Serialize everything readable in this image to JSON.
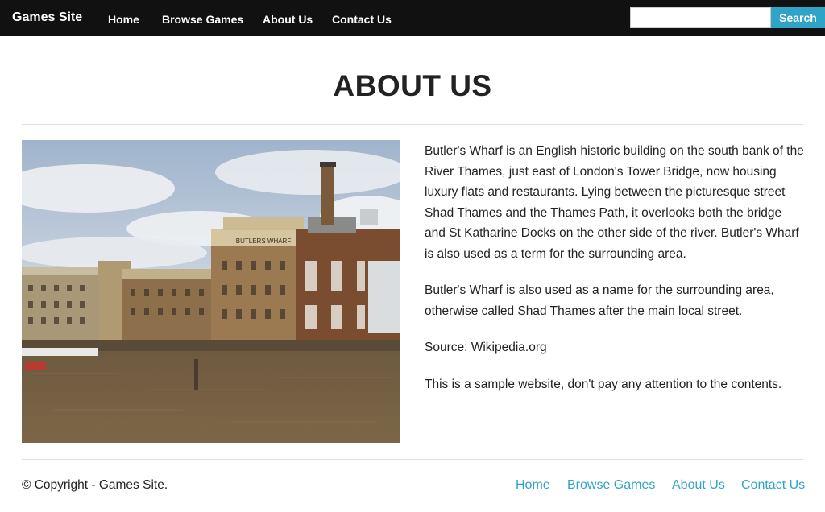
{
  "nav": {
    "brand": "Games Site",
    "links": [
      "Home",
      "Browse Games",
      "About Us",
      "Contact Us"
    ],
    "search_placeholder": "",
    "search_button": "Search"
  },
  "page": {
    "title": "ABOUT US",
    "image_alt": "Butler's Wharf building on the River Thames",
    "image_sign": "BUTLERS WHARF",
    "paragraphs": [
      "Butler's Wharf is an English historic building on the south bank of the River Thames, just east of London's Tower Bridge, now housing luxury flats and restaurants. Lying between the picturesque street Shad Thames and the Thames Path, it overlooks both the bridge and St Katharine Docks on the other side of the river. Butler's Wharf is also used as a term for the surrounding area.",
      "Butler's Wharf is also used as a name for the surrounding area, otherwise called Shad Thames after the main local street.",
      "Source: Wikipedia.org",
      "This is a sample website, don't pay any attention to the contents."
    ]
  },
  "footer": {
    "copyright": "© Copyright - Games Site.",
    "links": [
      "Home",
      "Browse Games",
      "About Us",
      "Contact Us"
    ]
  },
  "colors": {
    "navbar_bg": "#111111",
    "accent": "#2fa4c7",
    "text": "#222222",
    "divider": "#dddddd"
  }
}
